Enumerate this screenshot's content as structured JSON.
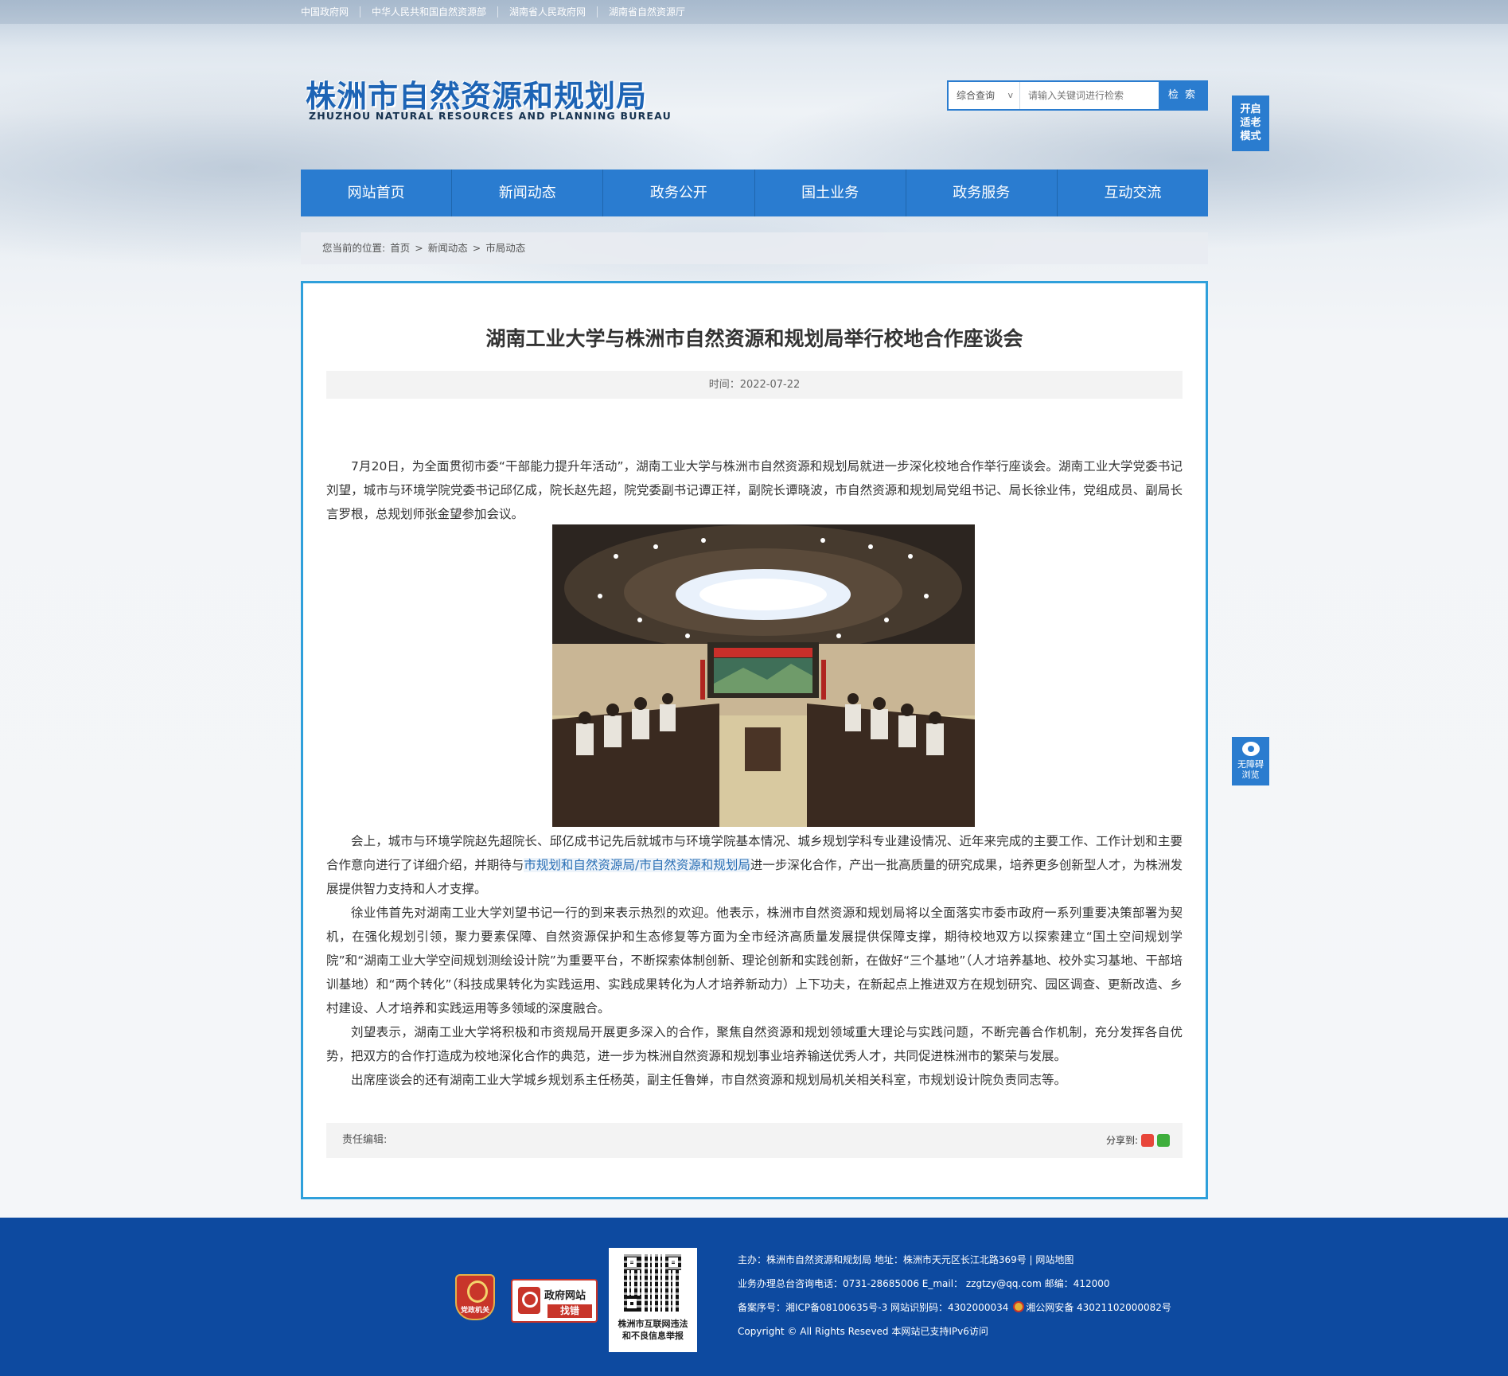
{
  "top_links": [
    "中国政府网",
    "中华人民共和国自然资源部",
    "湖南省人民政府网",
    "湖南省自然资源厅"
  ],
  "logo": {
    "cn": "株洲市自然资源和规划局",
    "en": "ZHUZHOU NATURAL RESOURCES AND PLANNING BUREAU"
  },
  "search": {
    "scope": "综合查询",
    "placeholder": "请输入关键词进行检索",
    "button": "检 索"
  },
  "side": {
    "elder_mode": [
      "开启",
      "适老",
      "模式"
    ],
    "accessible": [
      "无障碍",
      "浏览"
    ]
  },
  "nav": [
    "网站首页",
    "新闻动态",
    "政务公开",
    "国土业务",
    "政务服务",
    "互动交流"
  ],
  "breadcrumb": {
    "label": "您当前的位置:",
    "items": [
      "首页",
      ">",
      "新闻动态",
      ">",
      "市局动态"
    ]
  },
  "article": {
    "title": "湖南工业大学与株洲市自然资源和规划局举行校地合作座谈会",
    "meta": "时间：2022-07-22",
    "p1": "7月20日，为全面贯彻市委“干部能力提升年活动”，湖南工业大学与株洲市自然资源和规划局就进一步深化校地合作举行座谈会。湖南工业大学党委书记刘望，城市与环境学院党委书记邱亿成，院长赵先超，院党委副书记谭正祥，副院长谭晓波，市自然资源和规划局党组书记、局长徐业伟，党组成员、副局长言罗根，总规划师张金望参加会议。",
    "p2_a": "会上，城市与环境学院赵先超院长、邱亿成书记先后就城市与环境学院基本情况、城乡规划学科专业建设情况、近年来完成的主要工作、工作计划和主要合作意向进行了详细介绍，并期待与",
    "p2_link": "市规划和自然资源局/市自然资源和规划局",
    "p2_b": "进一步深化合作，产出一批高质量的研究成果，培养更多创新型人才，为株洲发展提供智力支持和人才支撑。",
    "p3": "徐业伟首先对湖南工业大学刘望书记一行的到来表示热烈的欢迎。他表示，株洲市自然资源和规划局将以全面落实市委市政府一系列重要决策部署为契机，在强化规划引领，聚力要素保障、自然资源保护和生态修复等方面为全市经济高质量发展提供保障支撑，期待校地双方以探索建立“国土空间规划学院”和“湖南工业大学空间规划测绘设计院”为重要平台，不断探索体制创新、理论创新和实践创新，在做好“三个基地”（人才培养基地、校外实习基地、干部培训基地）和“两个转化”（科技成果转化为实践运用、实践成果转化为人才培养新动力）上下功夫，在新起点上推进双方在规划研究、园区调查、更新改造、乡村建设、人才培养和实践运用等多领域的深度融合。",
    "p4": "刘望表示，湖南工业大学将积极和市资规局开展更多深入的合作，聚焦自然资源和规划领域重大理论与实践问题，不断完善合作机制，充分发挥各自优势，把双方的合作打造成为校地深化合作的典范，进一步为株洲自然资源和规划事业培养输送优秀人才，共同促进株洲市的繁荣与发展。",
    "p5": "出席座谈会的还有湖南工业大学城乡规划系主任杨英，副主任鲁婵，市自然资源和规划局机关相关科室，市规划设计院负责同志等。",
    "photo_banner": "湖南工业大学与株洲市自然资源和规划局校地合作座谈会",
    "editor_label": "责任编辑:",
    "share_label": "分享到:"
  },
  "footer": {
    "emblem_text": "党政机关",
    "gov_badge": [
      "政府网站",
      "找错"
    ],
    "qr_caption": [
      "株洲市互联网违法",
      "和不良信息举报"
    ],
    "line1": "主办：株洲市自然资源和规划局   地址：株洲市天元区长江北路369号  |  网站地图",
    "line2": "业务办理总台咨询电话：0731-28685006    E_mail：  zzgtzy@qq.com    邮编：412000",
    "line3_a": "备案序号：湘ICP备08100635号-3  网站识别码：4302000034",
    "line3_b": "湘公网安备 43021102000082号",
    "line4": "Copyright © All Rights Reseved 本网站已支持IPv6访问"
  },
  "colors": {
    "brand_blue": "#2a7cd0",
    "article_border": "#2fa0db",
    "footer_bg": "#0d4aa0"
  }
}
